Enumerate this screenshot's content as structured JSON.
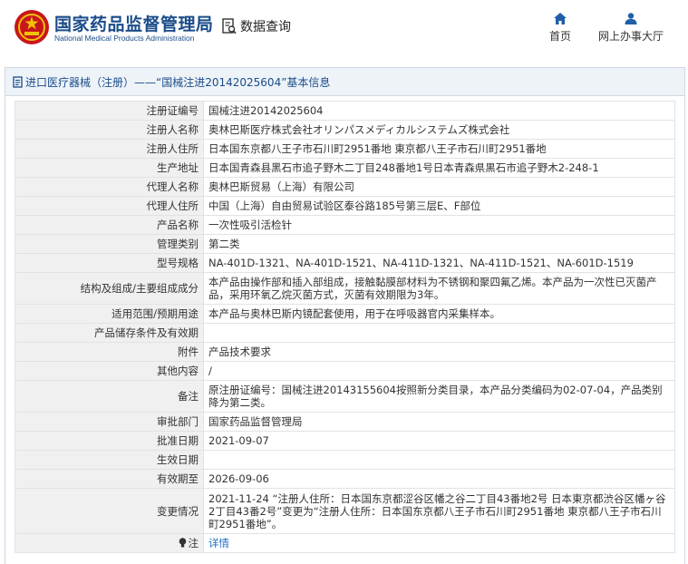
{
  "header": {
    "title": "国家药品监督管理局",
    "subtitle": "National Medical Products Administration",
    "search_label": "数据查询",
    "nav": [
      {
        "label": "首页",
        "icon": "home-icon"
      },
      {
        "label": "网上办事大厅",
        "icon": "user-icon"
      }
    ]
  },
  "panel": {
    "title": "进口医疗器械（注册）——“国械注进20142025604”基本信息"
  },
  "rows": [
    {
      "key": "注册证编号",
      "value": "国械注进20142025604"
    },
    {
      "key": "注册人名称",
      "value": "奥林巴斯医疗株式会社オリンパスメディカルシステムズ株式会社"
    },
    {
      "key": "注册人住所",
      "value": "日本国东京都八王子市石川町2951番地 東京都八王子市石川町2951番地"
    },
    {
      "key": "生产地址",
      "value": "日本国青森县黑石市追子野木二丁目248番地1号日本青森県黒石市追子野木2-248-1"
    },
    {
      "key": "代理人名称",
      "value": "奥林巴斯贸易（上海）有限公司"
    },
    {
      "key": "代理人住所",
      "value": "中国（上海）自由贸易试验区泰谷路185号第三层E、F部位"
    },
    {
      "key": "产品名称",
      "value": "一次性吸引活检针"
    },
    {
      "key": "管理类别",
      "value": "第二类"
    },
    {
      "key": "型号规格",
      "value": "NA-401D-1321、NA-401D-1521、NA-411D-1321、NA-411D-1521、NA-601D-1519"
    },
    {
      "key": "结构及组成/主要组成成分",
      "value": "本产品由操作部和插入部组成，接触黏膜部材料为不锈钢和聚四氟乙烯。本产品为一次性已灭菌产品，采用环氧乙烷灭菌方式，灭菌有效期限为3年。"
    },
    {
      "key": "适用范围/预期用途",
      "value": "本产品与奥林巴斯内镜配套使用，用于在呼吸器官内采集样本。"
    },
    {
      "key": "产品储存条件及有效期",
      "value": ""
    },
    {
      "key": "附件",
      "value": "产品技术要求"
    },
    {
      "key": "其他内容",
      "value": "/"
    },
    {
      "key": "备注",
      "value": "原注册证编号：国械注进20143155604按照新分类目录，本产品分类编码为02-07-04，产品类别降为第二类。"
    },
    {
      "key": "审批部门",
      "value": "国家药品监督管理局"
    },
    {
      "key": "批准日期",
      "value": "2021-09-07"
    },
    {
      "key": "生效日期",
      "value": ""
    },
    {
      "key": "有效期至",
      "value": "2026-09-06"
    },
    {
      "key": "变更情况",
      "value": "2021-11-24 “注册人住所：日本国东京都涩谷区幡之谷二丁目43番地2号 日本東京都渋谷区幡ヶ谷2丁目43番2号”变更为“注册人住所：日本国东京都八王子市石川町2951番地 東京都八王子市石川町2951番地”。"
    }
  ],
  "note": {
    "key": "注",
    "value": "详情",
    "icon": "bulb-icon"
  },
  "colors": {
    "brand": "#1a4c8a",
    "link": "#1f6fc8",
    "header_bg": "#eef3f8"
  }
}
